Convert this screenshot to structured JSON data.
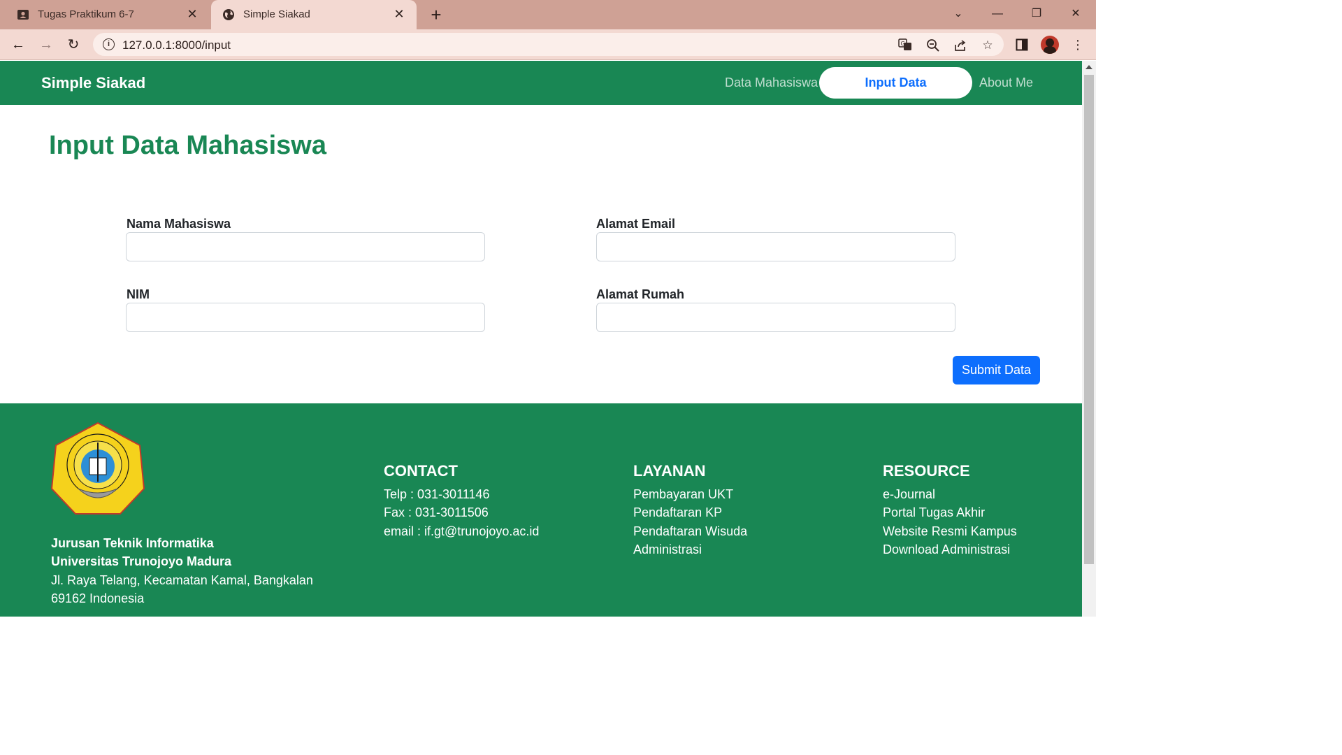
{
  "browser": {
    "tabs": [
      {
        "title": "Tugas Praktikum 6-7",
        "active": false
      },
      {
        "title": "Simple Siakad",
        "active": true
      }
    ],
    "url": "127.0.0.1:8000/input"
  },
  "navbar": {
    "brand": "Simple Siakad",
    "links": [
      "Data Mahasiswa",
      "Input Data",
      "About Me"
    ],
    "active": "Input Data"
  },
  "page": {
    "title": "Input Data Mahasiswa",
    "fields": [
      {
        "label": "Nama Mahasiswa",
        "value": "",
        "placeholder": ""
      },
      {
        "label": "Alamat Email",
        "value": "",
        "placeholder": ""
      },
      {
        "label": "NIM",
        "value": "",
        "placeholder": ""
      },
      {
        "label": "Alamat Rumah",
        "value": "",
        "placeholder": ""
      }
    ],
    "submit_label": "Submit Data"
  },
  "footer": {
    "department": "Jurusan Teknik Informatika",
    "university": "Universitas Trunojoyo Madura",
    "address_line1": "Jl. Raya Telang, Kecamatan Kamal, Bangkalan",
    "address_line2": "69162 Indonesia",
    "contact": {
      "heading": "CONTACT",
      "items": [
        "Telp : 031-3011146",
        "Fax : 031-3011506",
        "email : if.gt@trunojoyo.ac.id"
      ]
    },
    "layanan": {
      "heading": "LAYANAN",
      "items": [
        "Pembayaran UKT",
        "Pendaftaran KP",
        "Pendaftaran Wisuda",
        "Administrasi"
      ]
    },
    "resource": {
      "heading": "RESOURCE",
      "items": [
        "e-Journal",
        "Portal Tugas Akhir",
        "Website Resmi Kampus",
        "Download Administrasi"
      ]
    }
  },
  "colors": {
    "primary_green": "#198754",
    "primary_blue": "#0d6efd",
    "tab_bar": "#cfa195"
  }
}
